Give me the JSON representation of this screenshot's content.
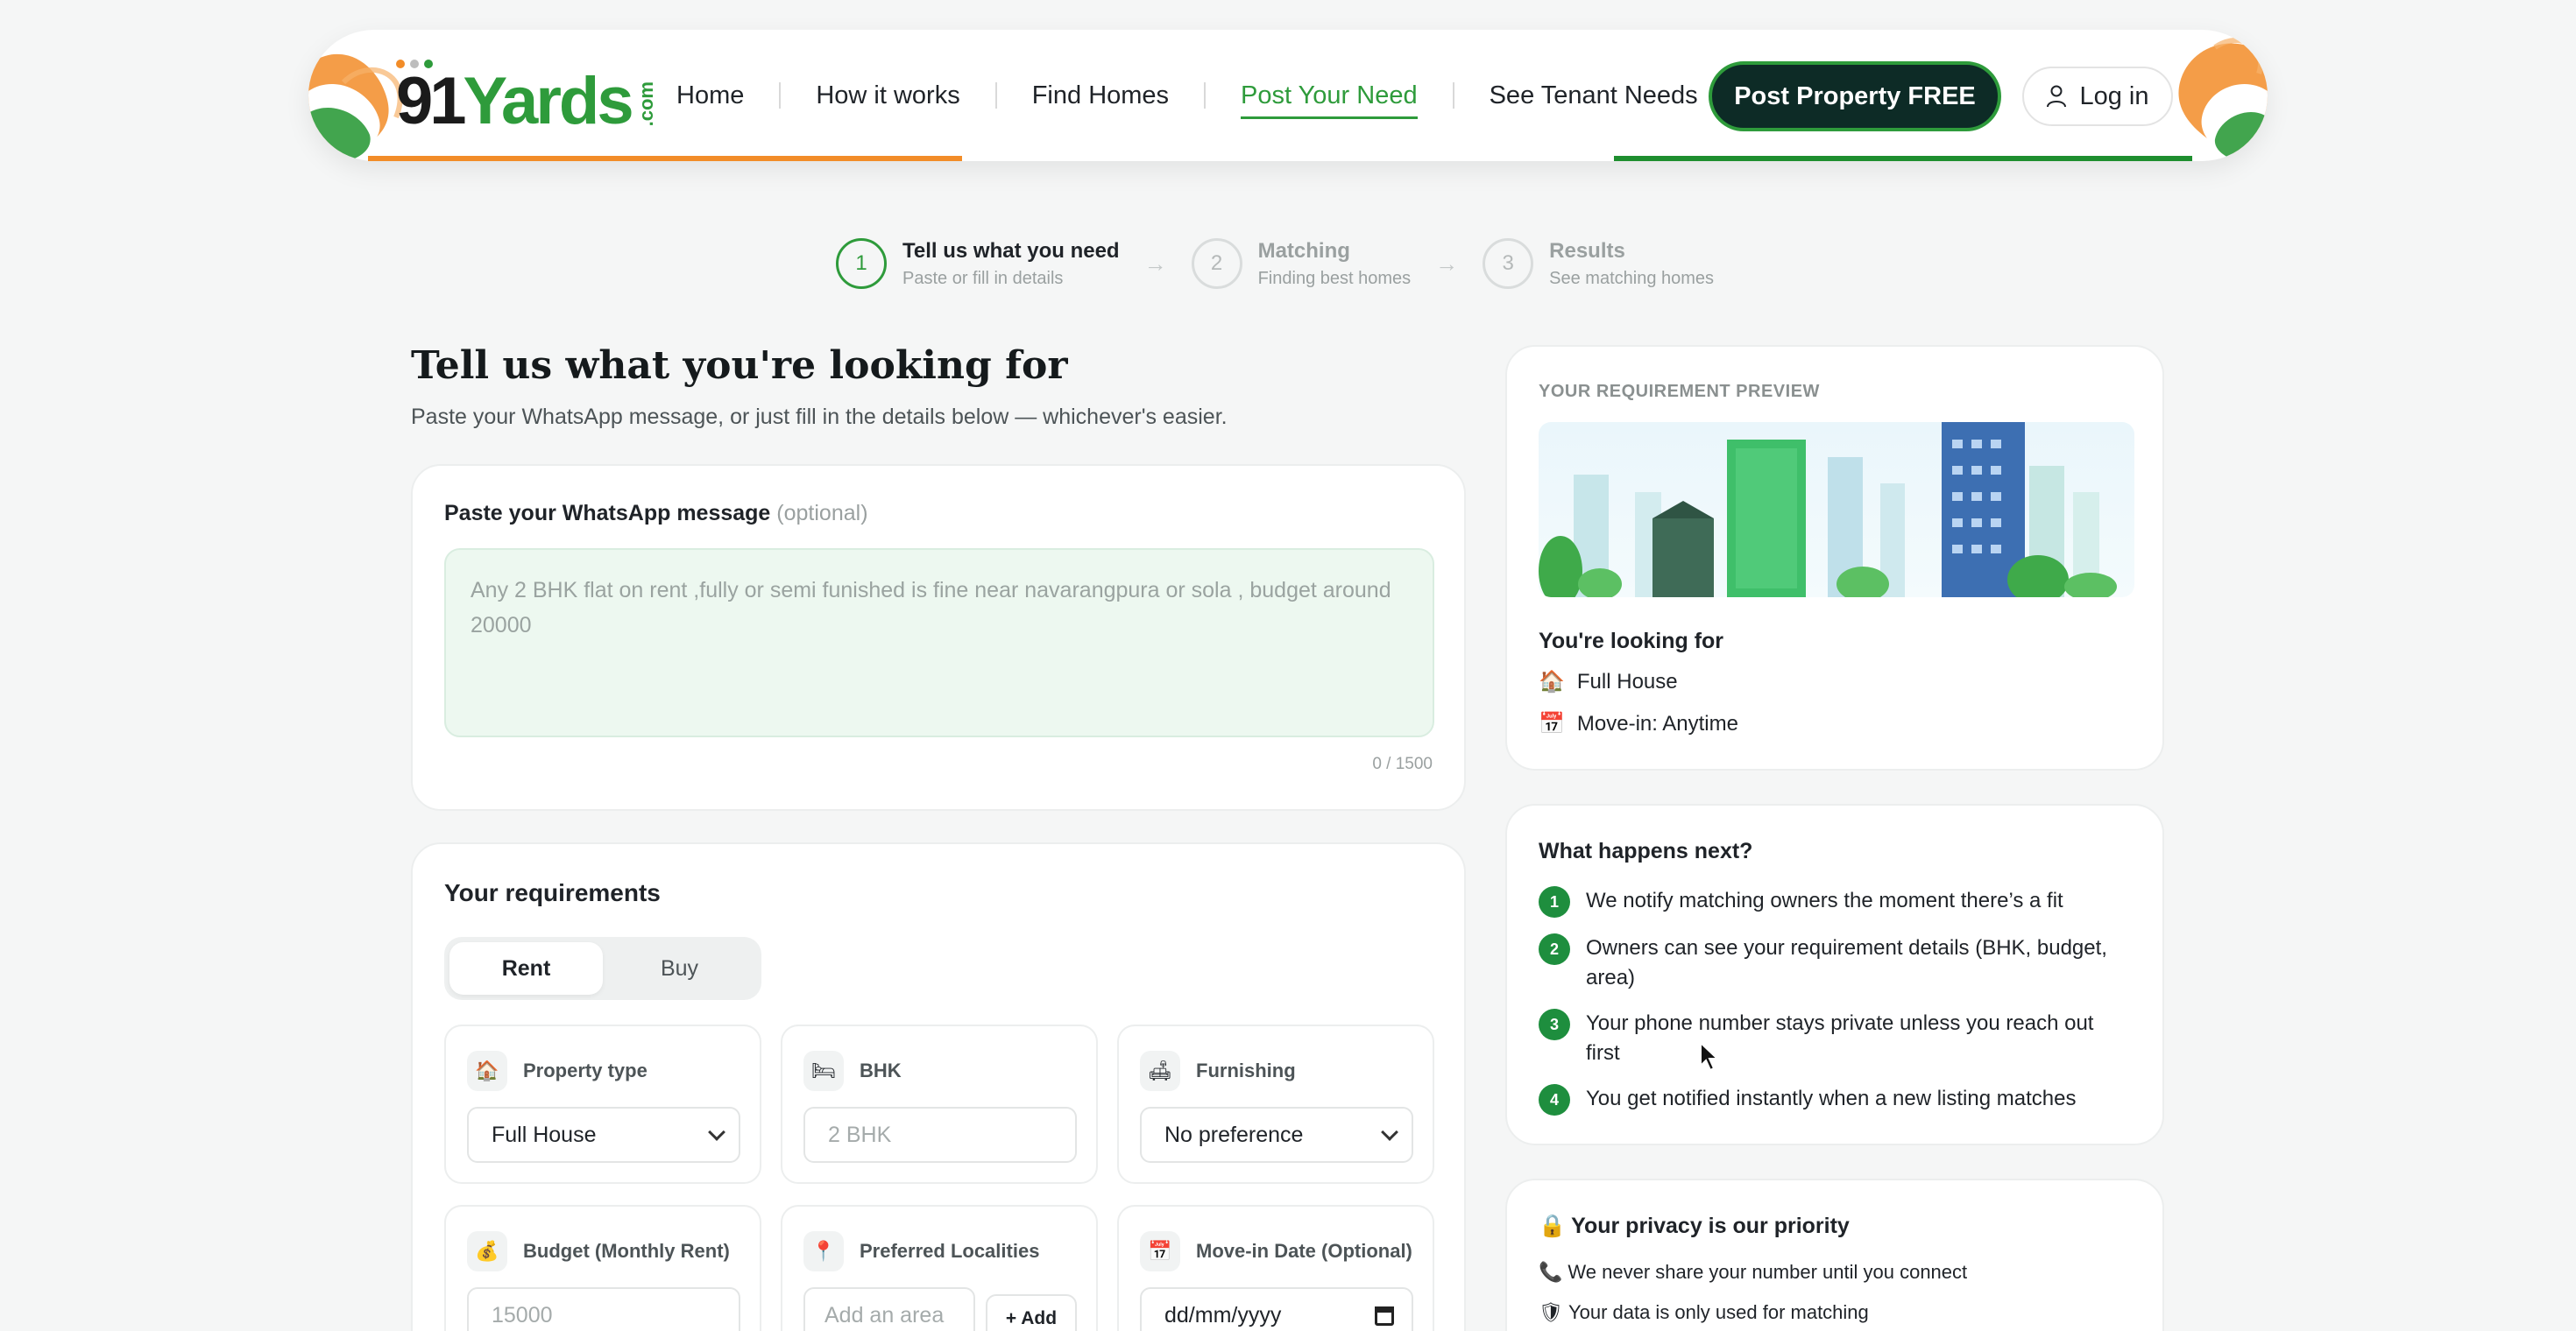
{
  "header": {
    "logo": {
      "number": "91",
      "name": "Yards",
      "tld": ".com"
    },
    "nav": [
      {
        "label": "Home"
      },
      {
        "label": "How it works"
      },
      {
        "label": "Find Homes"
      },
      {
        "label": "Post Your Need",
        "active": true
      },
      {
        "label": "See Tenant Needs"
      }
    ],
    "cta_label": "Post Property FREE",
    "login_label": "Log in",
    "colors": {
      "saffron": "#f28c28",
      "green": "#1e8e2f",
      "dark": "#0d2b26"
    }
  },
  "stepper": [
    {
      "num": "1",
      "title": "Tell us what you need",
      "sub": "Paste or fill in details",
      "active": true
    },
    {
      "num": "2",
      "title": "Matching",
      "sub": "Finding best homes"
    },
    {
      "num": "3",
      "title": "Results",
      "sub": "See matching homes"
    }
  ],
  "main": {
    "title": "Tell us what you're looking for",
    "subtitle": "Paste your WhatsApp message, or just fill in the details below — whichever's easier.",
    "paste": {
      "label": "Paste your WhatsApp message",
      "optional": "(optional)",
      "placeholder": "Any 2 BHK flat on rent ,fully or semi funished is fine near navarangpura or sola , budget around 20000",
      "count": "0 / 1500"
    },
    "requirements": {
      "title": "Your requirements",
      "modes": [
        "Rent",
        "Buy"
      ],
      "selected_mode": "Rent",
      "fields": {
        "property_type": {
          "label": "Property type",
          "value": "Full House",
          "icon": "house-icon"
        },
        "bhk": {
          "label": "BHK",
          "placeholder": "2 BHK",
          "icon": "bed-icon"
        },
        "furnishing": {
          "label": "Furnishing",
          "value": "No preference",
          "icon": "sofa-icon"
        },
        "budget": {
          "label": "Budget (Monthly Rent)",
          "placeholder": "15000",
          "icon": "money-bag-icon"
        },
        "localities": {
          "label": "Preferred Localities",
          "placeholder": "Add an area",
          "add_label": "+ Add",
          "icon": "pin-icon"
        },
        "move_in": {
          "label": "Move-in Date (Optional)",
          "placeholder": "dd/mm/yyyy",
          "icon": "calendar-icon"
        }
      }
    }
  },
  "sidebar": {
    "preview": {
      "label": "YOUR REQUIREMENT PREVIEW",
      "looking_for": "You're looking for",
      "items": [
        {
          "icon": "house-icon",
          "text": "Full House"
        },
        {
          "icon": "calendar-icon",
          "text": "Move-in: Anytime"
        }
      ]
    },
    "next": {
      "title": "What happens next?",
      "items": [
        {
          "num": "1",
          "text": "We notify matching owners the moment there’s a fit"
        },
        {
          "num": "2",
          "text": "Owners can see your requirement details (BHK, budget, area)"
        },
        {
          "num": "3",
          "text": "Your phone number stays private unless you reach out first"
        },
        {
          "num": "4",
          "text": "You get notified instantly when a new listing matches"
        }
      ]
    },
    "privacy": {
      "title": "Your privacy is our priority",
      "items": [
        {
          "icon": "phone-icon",
          "text": "We never share your number until you connect"
        },
        {
          "icon": "shield-icon",
          "text": "Your data is only used for matching"
        }
      ]
    }
  }
}
